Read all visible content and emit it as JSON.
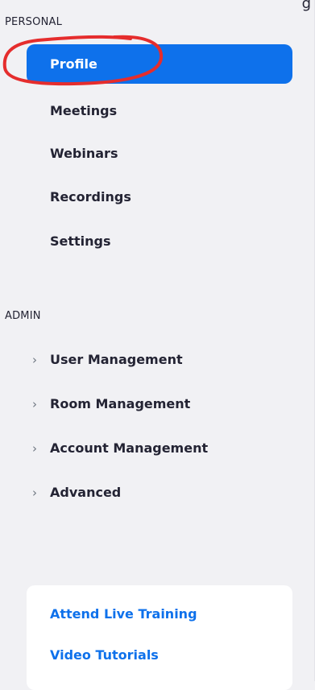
{
  "top_edge_text": "g",
  "sections": {
    "personal": "PERSONAL",
    "admin": "ADMIN"
  },
  "personal_items": [
    "Profile",
    "Meetings",
    "Webinars",
    "Recordings",
    "Settings"
  ],
  "admin_items": [
    "User Management",
    "Room Management",
    "Account Management",
    "Advanced"
  ],
  "help_links": [
    "Attend Live Training",
    "Video Tutorials"
  ],
  "colors": {
    "accent": "#0e71eb",
    "annotation": "#e52d2d",
    "sidebar_bg": "#f1f1f4"
  }
}
